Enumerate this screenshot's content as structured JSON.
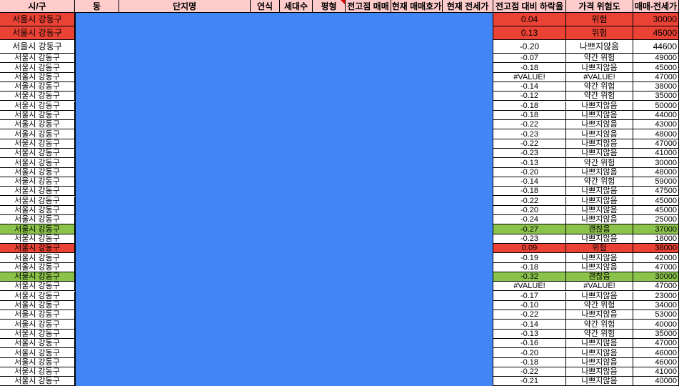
{
  "header": {
    "cols": [
      "시/구",
      "동",
      "단지명",
      "연식",
      "세대수",
      "평형",
      "전고점 매매",
      "현재 매매호가",
      "현재 전세가",
      "전고점 대비 하락율",
      "가격 위험도",
      "매매-전세가"
    ]
  },
  "colors": {
    "header_bg": "#ffcccc",
    "danger": "#ea4335",
    "good": "#8bc34a",
    "hidden_block": "#4285f4"
  },
  "rows": [
    {
      "city": "서울시 강동구",
      "drop": "0.04",
      "risk": "위험",
      "gap": "30000",
      "status": "danger",
      "tall": true
    },
    {
      "city": "서울시 강동구",
      "drop": "0.13",
      "risk": "위험",
      "gap": "45000",
      "status": "danger",
      "tall": true
    },
    {
      "city": "서울시 강동구",
      "drop": "-0.20",
      "risk": "나쁘지않음",
      "gap": "44600",
      "status": "normal",
      "tall": true
    },
    {
      "city": "서울시 강동구",
      "drop": "-0.07",
      "risk": "약간 위험",
      "gap": "49000",
      "status": "normal"
    },
    {
      "city": "서울시 강동구",
      "drop": "-0.18",
      "risk": "나쁘지않음",
      "gap": "45000",
      "status": "normal"
    },
    {
      "city": "서울시 강동구",
      "drop": "#VALUE!",
      "risk": "#VALUE!",
      "gap": "47000",
      "status": "normal"
    },
    {
      "city": "서울시 강동구",
      "drop": "-0.14",
      "risk": "약간 위험",
      "gap": "38000",
      "status": "normal"
    },
    {
      "city": "서울시 강동구",
      "drop": "-0.12",
      "risk": "약간 위험",
      "gap": "35000",
      "status": "normal"
    },
    {
      "city": "서울시 강동구",
      "drop": "-0.18",
      "risk": "나쁘지않음",
      "gap": "50000",
      "status": "normal"
    },
    {
      "city": "서울시 강동구",
      "drop": "-0.18",
      "risk": "나쁘지않음",
      "gap": "44000",
      "status": "normal"
    },
    {
      "city": "서울시 강동구",
      "drop": "-0.22",
      "risk": "나쁘지않음",
      "gap": "43000",
      "status": "normal"
    },
    {
      "city": "서울시 강동구",
      "drop": "-0.23",
      "risk": "나쁘지않음",
      "gap": "48000",
      "status": "normal"
    },
    {
      "city": "서울시 강동구",
      "drop": "-0.22",
      "risk": "나쁘지않음",
      "gap": "47000",
      "status": "normal"
    },
    {
      "city": "서울시 강동구",
      "drop": "-0.23",
      "risk": "나쁘지않음",
      "gap": "41000",
      "status": "normal"
    },
    {
      "city": "서울시 강동구",
      "drop": "-0.13",
      "risk": "약간 위험",
      "gap": "30000",
      "status": "normal"
    },
    {
      "city": "서울시 강동구",
      "drop": "-0.20",
      "risk": "나쁘지않음",
      "gap": "48000",
      "status": "normal"
    },
    {
      "city": "서울시 강동구",
      "drop": "-0.14",
      "risk": "약간 위험",
      "gap": "59000",
      "status": "normal"
    },
    {
      "city": "서울시 강동구",
      "drop": "-0.18",
      "risk": "나쁘지않음",
      "gap": "47500",
      "status": "normal"
    },
    {
      "city": "서울시 강동구",
      "drop": "-0.22",
      "risk": "나쁘지않음",
      "gap": "45000",
      "status": "normal"
    },
    {
      "city": "서울시 강동구",
      "drop": "-0.20",
      "risk": "나쁘지않음",
      "gap": "45000",
      "status": "normal"
    },
    {
      "city": "서울시 강동구",
      "drop": "-0.24",
      "risk": "나쁘지않음",
      "gap": "25000",
      "status": "normal"
    },
    {
      "city": "서울시 강동구",
      "drop": "-0.27",
      "risk": "괜찮음",
      "gap": "37000",
      "status": "good"
    },
    {
      "city": "서울시 강동구",
      "drop": "-0.23",
      "risk": "나쁘지않음",
      "gap": "18000",
      "status": "normal"
    },
    {
      "city": "서울시 강동구",
      "drop": "0.09",
      "risk": "위험",
      "gap": "38000",
      "status": "danger"
    },
    {
      "city": "서울시 강동구",
      "drop": "-0.19",
      "risk": "나쁘지않음",
      "gap": "42000",
      "status": "normal"
    },
    {
      "city": "서울시 강동구",
      "drop": "-0.18",
      "risk": "나쁘지않음",
      "gap": "47000",
      "status": "normal"
    },
    {
      "city": "서울시 강동구",
      "drop": "-0.32",
      "risk": "괜찮음",
      "gap": "30000",
      "status": "good"
    },
    {
      "city": "서울시 강동구",
      "drop": "#VALUE!",
      "risk": "#VALUE!",
      "gap": "47000",
      "status": "normal"
    },
    {
      "city": "서울시 강동구",
      "drop": "-0.17",
      "risk": "나쁘지않음",
      "gap": "23000",
      "status": "normal"
    },
    {
      "city": "서울시 강동구",
      "drop": "-0.10",
      "risk": "약간 위험",
      "gap": "34000",
      "status": "normal"
    },
    {
      "city": "서울시 강동구",
      "drop": "-0.22",
      "risk": "나쁘지않음",
      "gap": "53000",
      "status": "normal"
    },
    {
      "city": "서울시 강동구",
      "drop": "-0.14",
      "risk": "약간 위험",
      "gap": "40000",
      "status": "normal"
    },
    {
      "city": "서울시 강동구",
      "drop": "-0.13",
      "risk": "약간 위험",
      "gap": "35000",
      "status": "normal"
    },
    {
      "city": "서울시 강동구",
      "drop": "-0.16",
      "risk": "나쁘지않음",
      "gap": "47000",
      "status": "normal"
    },
    {
      "city": "서울시 강동구",
      "drop": "-0.20",
      "risk": "나쁘지않음",
      "gap": "46000",
      "status": "normal"
    },
    {
      "city": "서울시 강동구",
      "drop": "-0.18",
      "risk": "나쁘지않음",
      "gap": "46000",
      "status": "normal"
    },
    {
      "city": "서울시 강동구",
      "drop": "-0.22",
      "risk": "나쁘지않음",
      "gap": "41000",
      "status": "normal"
    },
    {
      "city": "서울시 강동구",
      "drop": "-0.21",
      "risk": "나쁘지않음",
      "gap": "40000",
      "status": "normal"
    }
  ]
}
